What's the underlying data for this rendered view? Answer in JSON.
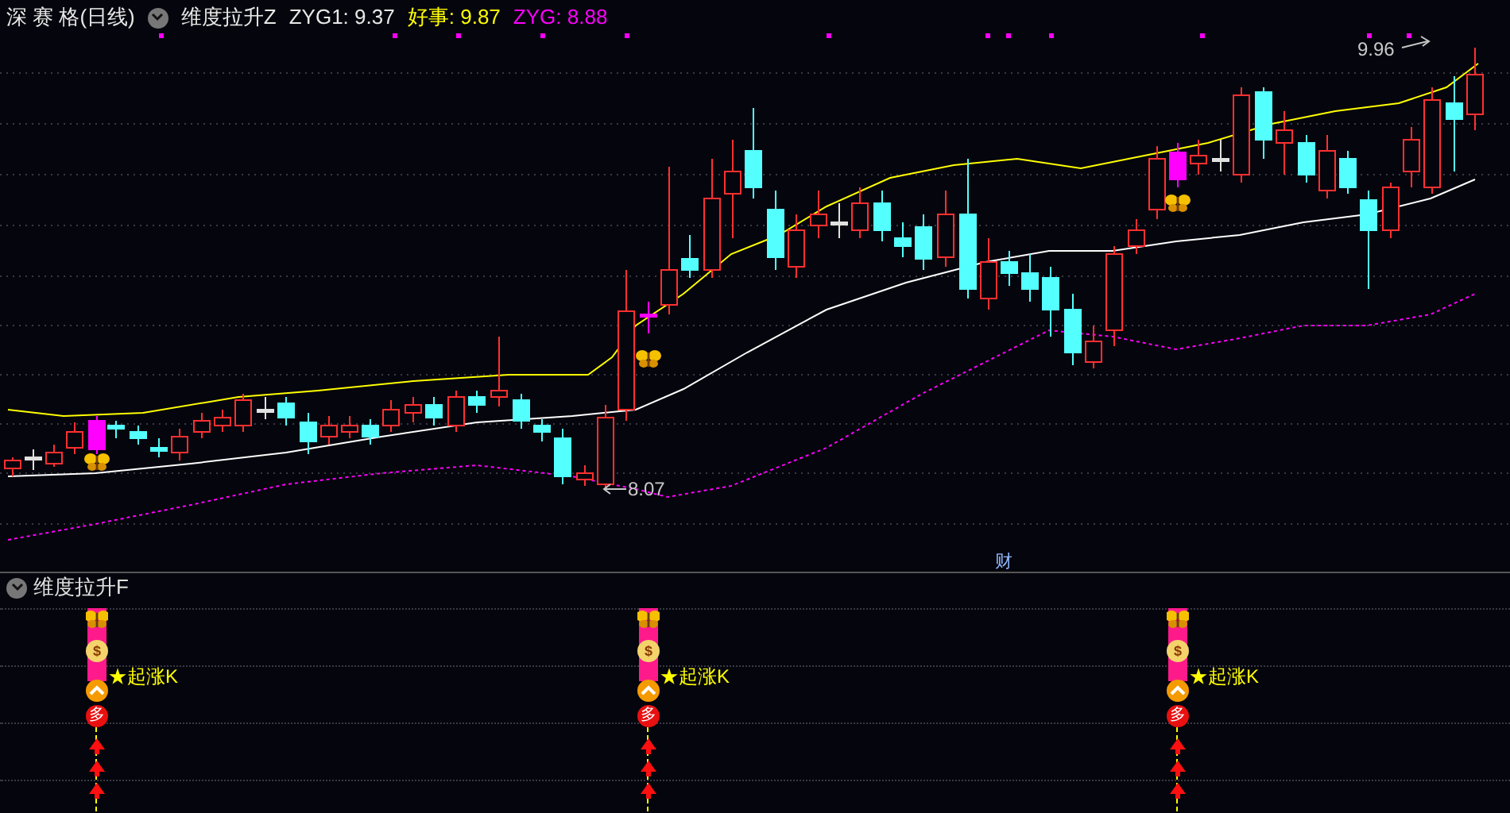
{
  "header": {
    "stock_name": "深 赛 格(日线)",
    "indicator": "维度拉升Z",
    "values": [
      {
        "label": "ZYG1:",
        "value": "9.37",
        "color": "#e8e8e8"
      },
      {
        "label": "好事:",
        "value": "9.87",
        "color": "#ffff00"
      },
      {
        "label": "ZYG:",
        "value": "8.88",
        "color": "#ff00ff"
      }
    ]
  },
  "main_chart": {
    "high_label": "9.96",
    "low_label": "8.07",
    "marker": "财"
  },
  "sub_panel": {
    "title": "维度拉升F",
    "signals": [
      {
        "bag_label": "$",
        "label": "★起涨K",
        "badge": "多"
      },
      {
        "bag_label": "$",
        "label": "★起涨K",
        "badge": "多"
      },
      {
        "bag_label": "$",
        "label": "★起涨K",
        "badge": "多"
      }
    ]
  }
}
